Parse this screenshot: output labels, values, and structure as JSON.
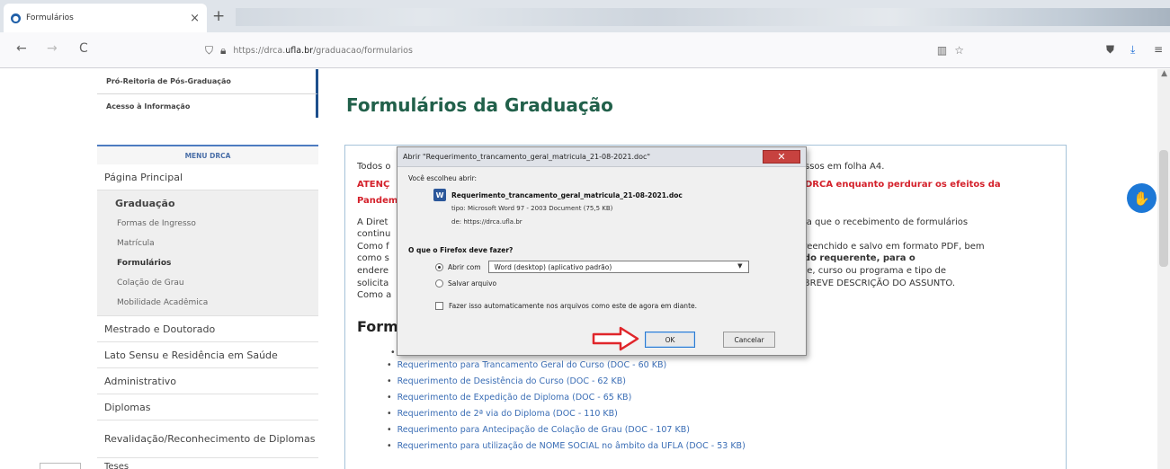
{
  "browser": {
    "tab_title": "Formulários",
    "tab_close": "×",
    "new_tab": "+",
    "back": "←",
    "forward": "→",
    "reload": "C",
    "url_prefix": "https://drca.",
    "url_domain": "ufla.br",
    "url_path": "/graduacao/formularios",
    "icons": [
      "shield-icon",
      "lock-icon",
      "reader-icon",
      "bookmark-star-icon",
      "pocket-icon",
      "download-icon",
      "menu-icon"
    ]
  },
  "sidebar": {
    "top_links": [
      "Pró-Reitoria de Pós-Graduação",
      "Acesso à Informação"
    ],
    "menu_title": "MENU DRCA",
    "home": "Página Principal",
    "graduacao": {
      "title": "Graduação",
      "items": [
        "Formas de Ingresso",
        "Matrícula",
        "Formulários",
        "Colação de Grau",
        "Mobilidade Acadêmica"
      ],
      "active": "Formulários"
    },
    "items": [
      "Mestrado e Doutorado",
      "Lato Sensu e Residência em Saúde",
      "Administrativo",
      "Diplomas",
      "Revalidação/Reconhecimento de Diplomas"
    ],
    "tail": "Teses"
  },
  "main": {
    "title": "Formulários da Graduação",
    "p1_start": "Todos o",
    "p1_end": "ssos em folha A4.",
    "warn_start": "ATENÇ",
    "warn_end": "DRCA enquanto perdurar os efeitos da",
    "warn_line2": "Pandem",
    "p2_lines_left": [
      "A Diret",
      "continu",
      "Como f",
      "como s",
      "endere",
      "solicita",
      "Como a"
    ],
    "p2_lines_right": [
      "ma que o recebimento de formulários",
      "",
      "preenchido e salvo em formato PDF, bem",
      "l do requerente, para o",
      "nte, curso ou programa e tipo de",
      " - BREVE DESCRIÇÃO DO ASSUNTO.",
      ""
    ],
    "forms_heading": "Form",
    "downloads": [
      "Requerimento para Trancamento Geral do Curso (DOC - 60 KB)",
      "Requerimento de Desistência do Curso (DOC - 62 KB)",
      "Requerimento de Expedição de Diploma (DOC - 65 KB)",
      "Requerimento de 2ª via do Diploma (DOC - 110 KB)",
      "Requerimento para Antecipação de Colação de Grau (DOC - 107 KB)",
      "Requerimento para utilização de NOME SOCIAL no âmbito da UFLA (DOC - 53 KB)"
    ]
  },
  "dialog": {
    "title": "Abrir \"Requerimento_trancamento_geral_matricula_21-08-2021.doc\"",
    "close": "✕",
    "intro": "Você escolheu abrir:",
    "filename": "Requerimento_trancamento_geral_matricula_21-08-2021.doc",
    "file_icon": "W",
    "type_line": "tipo: Microsoft Word 97 - 2003 Document (75,5 KB)",
    "from_line": "de: https://drca.ufla.br",
    "question": "O que o Firefox deve fazer?",
    "open_with_label": "Abrir com",
    "open_with_value": "Word (desktop) (aplicativo padrão)",
    "save_label": "Salvar arquivo",
    "auto_label": "Fazer isso automaticamente nos arquivos como este de agora em diante.",
    "ok": "OK",
    "cancel": "Cancelar"
  },
  "fab_icon": "accessibility-hand-icon"
}
